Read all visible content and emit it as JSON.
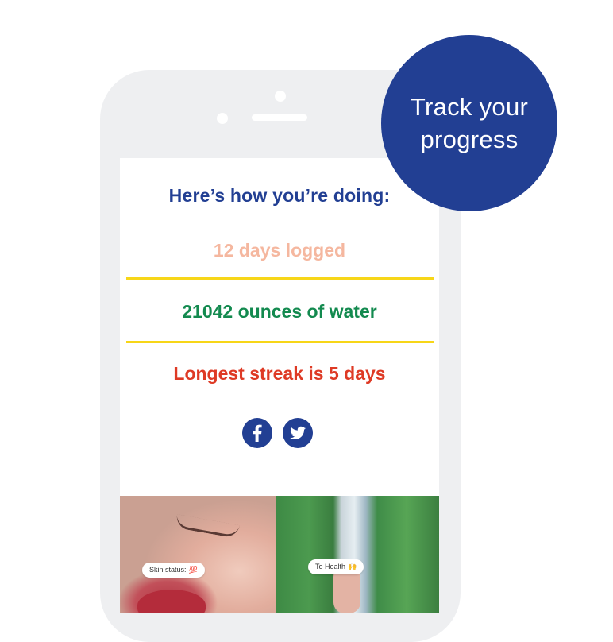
{
  "badge": {
    "line1": "Track your",
    "line2": "progress"
  },
  "screen": {
    "heading": "Here’s how you’re doing:",
    "stats": [
      {
        "label": "12 days logged"
      },
      {
        "label": "21042 ounces of water"
      },
      {
        "label": "Longest streak is 5 days"
      }
    ],
    "social": [
      {
        "name": "facebook",
        "glyph": "f"
      },
      {
        "name": "twitter"
      }
    ],
    "photos": [
      {
        "caption": "Skin status:",
        "emoji": "💯"
      },
      {
        "caption": "To Health",
        "emoji": "🙌"
      }
    ]
  },
  "colors": {
    "brand_blue": "#223f93",
    "days": "#f5b79f",
    "water": "#138a4f",
    "streak": "#de3a25",
    "divider": "#f7d618"
  },
  "icons": [
    "facebook-icon",
    "twitter-icon"
  ]
}
